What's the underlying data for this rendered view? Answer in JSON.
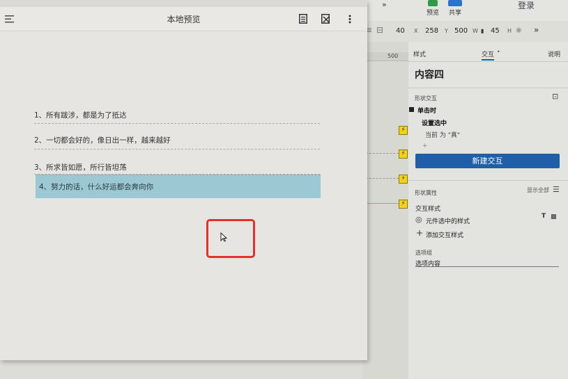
{
  "editor": {
    "toolbar": {
      "preview_label": "预览",
      "share_label": "共享",
      "login_label": "登录",
      "more": "»"
    },
    "props": {
      "x": "40",
      "x_label": "X",
      "y": "258",
      "y_label": "Y",
      "w": "500",
      "w_label": "W",
      "h": "45",
      "h_label": "H"
    },
    "ruler_mark": "500",
    "panel": {
      "tabs": [
        "样式",
        "交互",
        "说明"
      ],
      "active_tab": "交互",
      "title": "内容四",
      "shape_interaction": "形状交互",
      "event": "单击时",
      "action": "设置选中",
      "action_detail": "当前 为 \"真\"",
      "add_symbol": "+",
      "new_interaction": "新建交互",
      "shape_props": "形状属性",
      "show_all": "显示全部",
      "interaction_style": "交互样式",
      "selected_style": "元件选中的样式",
      "add_style": "添加交互样式",
      "option_group": "选项组",
      "option_value": "选项内容"
    }
  },
  "preview": {
    "title": "本地预览",
    "items": [
      {
        "text": "1、所有跋涉，都是为了抵达",
        "selected": false
      },
      {
        "text": "2、一切都会好的，像日出一样，越来越好",
        "selected": false
      },
      {
        "text": "3、所求皆如愿，所行皆坦荡",
        "selected": false
      },
      {
        "text": "4、努力的话，什么好运都会奔向你",
        "selected": true
      }
    ]
  },
  "colors": {
    "selected_bg": "#9cc8d3",
    "primary_button": "#1f5ea8",
    "highlight_box": "#e53030",
    "bolt": "#f2d21b"
  },
  "icons": [
    "menu-icon",
    "document-icon",
    "export-icon",
    "more-vertical-icon",
    "lightning-icon",
    "cursor-icon"
  ]
}
